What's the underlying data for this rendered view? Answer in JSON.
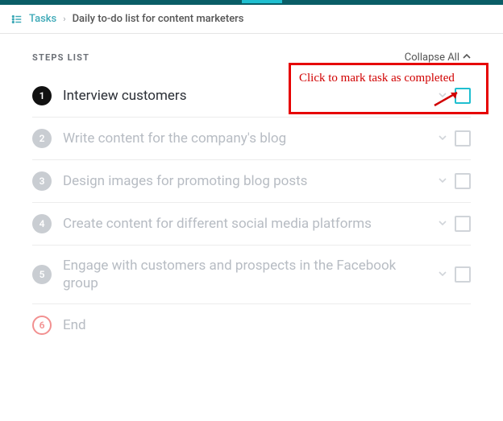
{
  "breadcrumb": {
    "tasks_label": "Tasks",
    "page_title": "Daily to-do list for content marketers"
  },
  "header": {
    "steps_list_label": "STEPS LIST",
    "collapse_all_label": "Collapse All"
  },
  "steps": [
    {
      "num": "1",
      "title": "Interview customers",
      "state": "active",
      "has_check": true
    },
    {
      "num": "2",
      "title": "Write content for the company's blog",
      "state": "inactive",
      "has_check": true
    },
    {
      "num": "3",
      "title": "Design images for promoting blog posts",
      "state": "inactive",
      "has_check": true
    },
    {
      "num": "4",
      "title": "Create content for different social media platforms",
      "state": "inactive",
      "has_check": true
    },
    {
      "num": "5",
      "title": "Engage with customers and prospects in the Facebook group",
      "state": "inactive",
      "has_check": true
    },
    {
      "num": "6",
      "title": "End",
      "state": "end",
      "has_check": false
    }
  ],
  "annotation": {
    "text": "Click to mark task as completed"
  },
  "colors": {
    "accent": "#1fbfd0",
    "callout": "#e60000"
  }
}
